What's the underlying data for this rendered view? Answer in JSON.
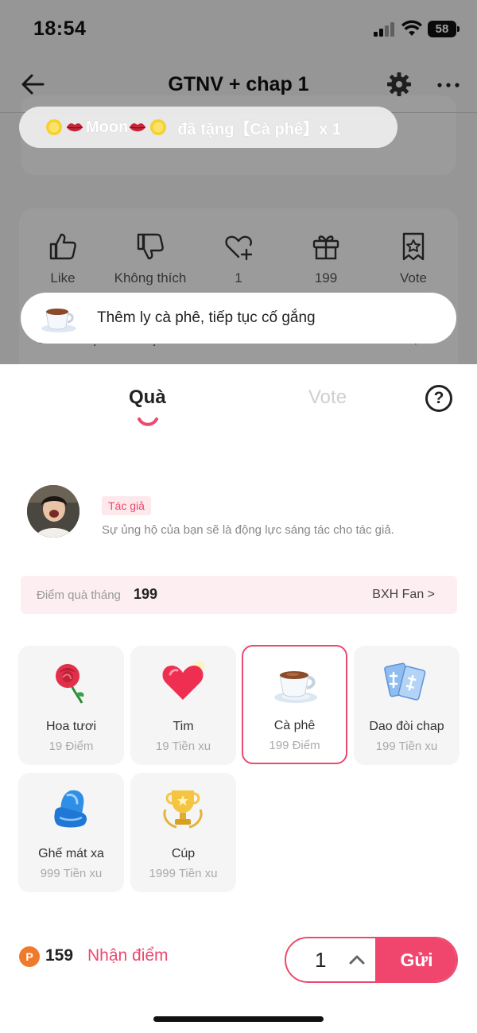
{
  "status_bar": {
    "time": "18:54",
    "battery": "58"
  },
  "nav": {
    "title": "GTNV + chap 1"
  },
  "background": {
    "actions": [
      {
        "label": "Like",
        "icon": "thumbs-up-icon"
      },
      {
        "label": "Không thích",
        "icon": "thumbs-down-icon"
      },
      {
        "label": "1",
        "icon": "heart-plus-icon"
      },
      {
        "label": "199",
        "icon": "gift-icon"
      },
      {
        "label": "Vote",
        "icon": "vote-ticket-icon"
      }
    ],
    "section_title": "Bình luận nổi bật",
    "section_count": "2 Bình luận >"
  },
  "toast_gift": {
    "user": "Moon",
    "message": "đã tặng【Cà phê】x 1"
  },
  "toast_info": {
    "message": "Thêm ly cà phê, tiếp tục cố gắng"
  },
  "sheet": {
    "tabs": [
      {
        "label": "Quà",
        "active": true
      },
      {
        "label": "Vote",
        "active": false
      }
    ],
    "help_label": "?",
    "author": {
      "tag": "Tác giả",
      "description": "Sự ủng hộ của bạn sẽ là động lực sáng tác cho tác giả."
    },
    "monthly": {
      "label": "Điểm quà tháng",
      "value": "199",
      "link": "BXH Fan >"
    },
    "gifts": [
      {
        "name": "Hoa tươi",
        "price": "19 Điểm",
        "icon": "rose-icon",
        "selected": false
      },
      {
        "name": "Tim",
        "price": "19 Tiền xu",
        "icon": "heart-icon",
        "selected": false
      },
      {
        "name": "Cà phê",
        "price": "199 Điểm",
        "icon": "coffee-cup-icon",
        "selected": true
      },
      {
        "name": "Dao đòi chap",
        "price": "199 Tiền xu",
        "icon": "blade-cards-icon",
        "selected": false
      },
      {
        "name": "Ghế mát xa",
        "price": "999 Tiền xu",
        "icon": "massage-chair-icon",
        "selected": false
      },
      {
        "name": "Cúp",
        "price": "1999 Tiền xu",
        "icon": "trophy-icon",
        "selected": false
      }
    ],
    "footer": {
      "points_badge": "P",
      "points": "159",
      "earn_label": "Nhận điểm",
      "quantity": "1",
      "send_label": "Gửi"
    }
  },
  "colors": {
    "accent": "#f0466e",
    "accent_soft": "#fdeef1",
    "points": "#f07a2c"
  }
}
